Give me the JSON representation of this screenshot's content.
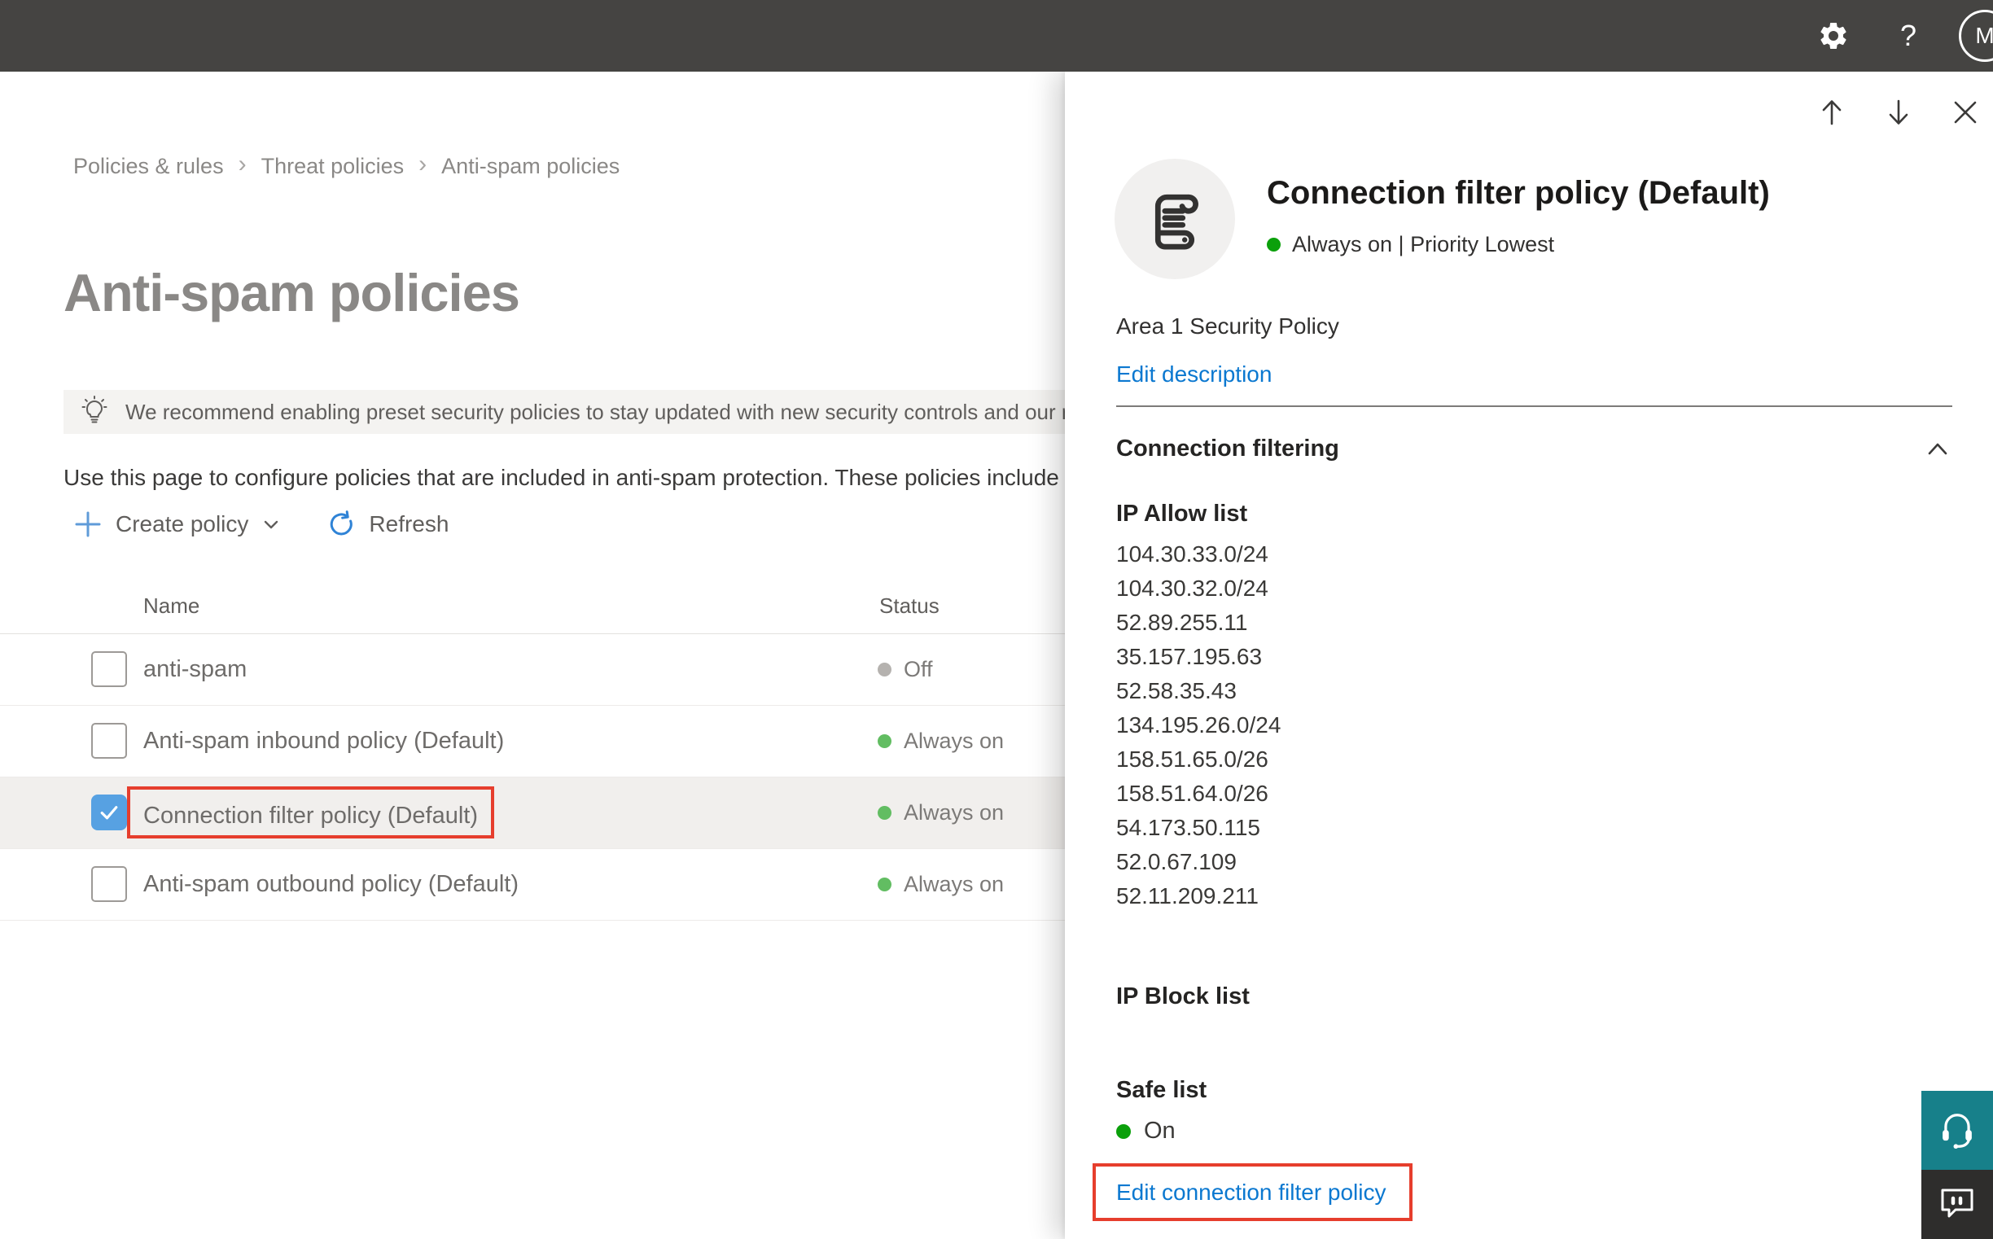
{
  "topbar": {
    "avatar_initial": "M"
  },
  "breadcrumb": [
    "Policies & rules",
    "Threat policies",
    "Anti-spam policies"
  ],
  "page": {
    "title": "Anti-spam policies",
    "banner_text": "We recommend enabling preset security policies to stay updated with new security controls and our recommendations.",
    "description": "Use this page to configure policies that are included in anti-spam protection. These policies include connection filtering."
  },
  "toolbar": {
    "create_label": "Create policy",
    "refresh_label": "Refresh"
  },
  "table": {
    "columns": [
      "Name",
      "Status"
    ],
    "rows": [
      {
        "name": "anti-spam",
        "status": "Off",
        "status_kind": "off",
        "checked": false,
        "selected": false,
        "name_outlined": false
      },
      {
        "name": "Anti-spam inbound policy (Default)",
        "status": "Always on",
        "status_kind": "on",
        "checked": false,
        "selected": false,
        "name_outlined": false
      },
      {
        "name": "Connection filter policy (Default)",
        "status": "Always on",
        "status_kind": "on",
        "checked": true,
        "selected": true,
        "name_outlined": true
      },
      {
        "name": "Anti-spam outbound policy (Default)",
        "status": "Always on",
        "status_kind": "on",
        "checked": false,
        "selected": false,
        "name_outlined": false
      }
    ]
  },
  "flyout": {
    "title": "Connection filter policy (Default)",
    "status_line": "Always on | Priority Lowest",
    "description": "Area 1 Security Policy",
    "edit_description_label": "Edit description",
    "section_title": "Connection filtering",
    "ip_allow_heading": "IP Allow list",
    "ip_allow_items": [
      "104.30.33.0/24",
      "104.30.32.0/24",
      "52.89.255.11",
      "35.157.195.63",
      "52.58.35.43",
      "134.195.26.0/24",
      "158.51.65.0/26",
      "158.51.64.0/26",
      "54.173.50.115",
      "52.0.67.109",
      "52.11.209.211"
    ],
    "ip_block_heading": "IP Block list",
    "safe_list_heading": "Safe list",
    "safe_list_status": "On",
    "edit_policy_label": "Edit connection filter policy"
  },
  "colors": {
    "accent_blue": "#0B78D0",
    "status_on_green": "#62BD62",
    "status_off_gray": "#B5B2AF",
    "flyout_status_green": "#0BA00B",
    "highlight_red": "#E63E2D",
    "support_teal": "#17808A",
    "feedback_dark": "#2E2D2C",
    "topbar_dark": "#454442"
  }
}
